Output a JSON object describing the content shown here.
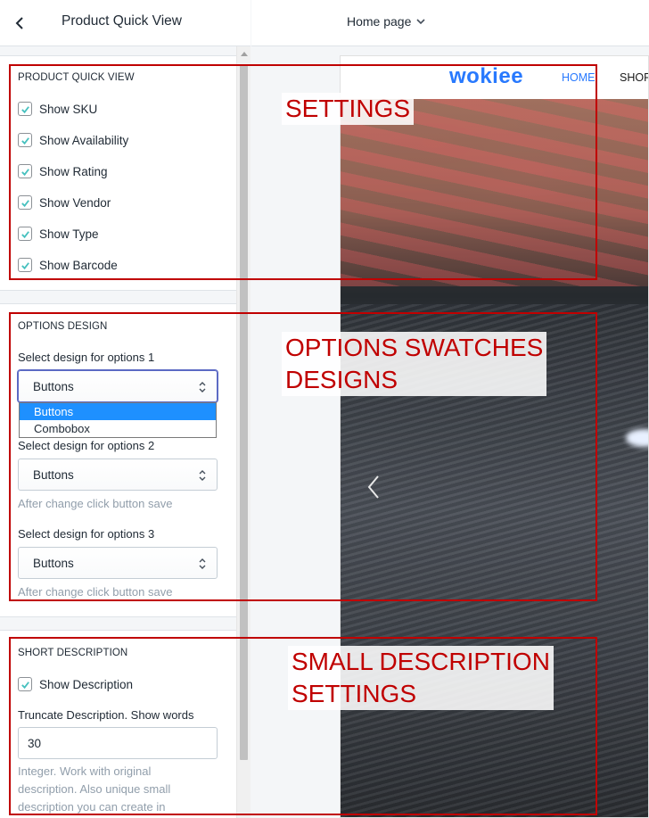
{
  "sidebar": {
    "title": "Product Quick View",
    "sections": {
      "quick_view": {
        "title": "PRODUCT QUICK VIEW",
        "checks": [
          {
            "label": "Show SKU",
            "checked": true
          },
          {
            "label": "Show Availability",
            "checked": true
          },
          {
            "label": "Show Rating",
            "checked": true
          },
          {
            "label": "Show Vendor",
            "checked": true
          },
          {
            "label": "Show Type",
            "checked": true
          },
          {
            "label": "Show Barcode",
            "checked": true
          }
        ]
      },
      "options_design": {
        "title": "OPTIONS DESIGN",
        "opt1_label": "Select design for options 1",
        "opt1_value": "Buttons",
        "dropdown_options": [
          "Buttons",
          "Combobox"
        ],
        "opt2_label": "Select design for options 2",
        "opt2_value": "Buttons",
        "opt2_help": "After change click button save",
        "opt3_label": "Select design for options 3",
        "opt3_value": "Buttons",
        "opt3_help": "After change click button save"
      },
      "short_description": {
        "title": "SHORT DESCRIPTION",
        "show_label": "Show Description",
        "show_checked": true,
        "truncate_label": "Truncate Description. Show words",
        "truncate_value": "30",
        "help": "Integer. Work with original description. Also unique small description you can create in"
      }
    }
  },
  "preview": {
    "page_select": "Home page",
    "logo": "wokiee",
    "nav": {
      "home": "HOME",
      "shop": "SHOP"
    }
  },
  "annotations": {
    "settings": "SETTINGS",
    "options": "OPTIONS SWATCHES\nDESIGNS",
    "description": "SMALL DESCRIPTION\nSETTINGS"
  },
  "colors": {
    "annotation": "#c00000",
    "brand": "#2879fe",
    "dropdown_selected": "#1e90ff"
  }
}
